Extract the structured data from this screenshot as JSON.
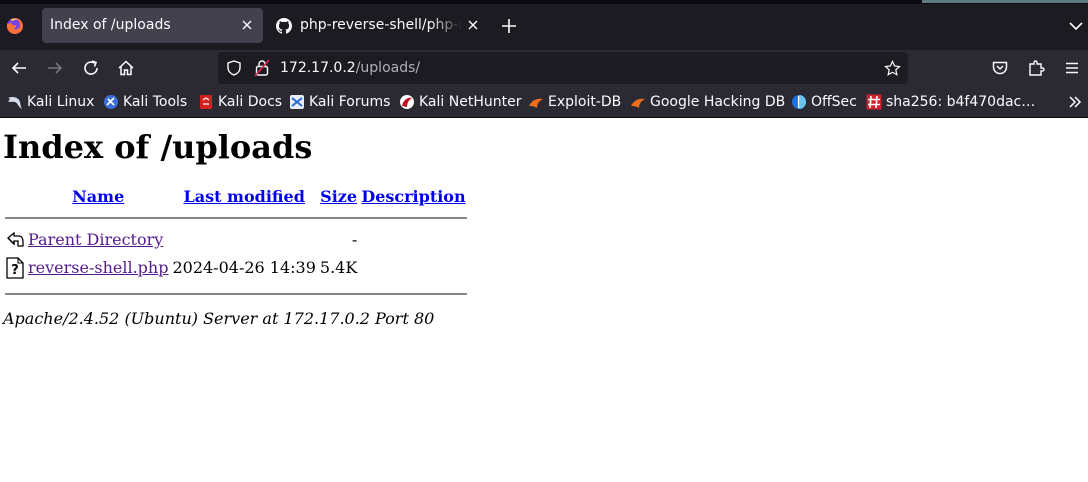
{
  "browser": {
    "tabs": [
      {
        "title": "Index of /uploads",
        "active": true
      },
      {
        "title": "php-reverse-shell/php-re",
        "active": false
      }
    ],
    "url": {
      "host": "172.17.0.2",
      "path": "/uploads/"
    },
    "bookmarks": [
      {
        "label": "Kali Linux",
        "icon": "kali-dragon-icon"
      },
      {
        "label": "Kali Tools",
        "icon": "kali-tools-icon"
      },
      {
        "label": "Kali Docs",
        "icon": "kali-docs-icon"
      },
      {
        "label": "Kali Forums",
        "icon": "kali-forums-icon"
      },
      {
        "label": "Kali NetHunter",
        "icon": "kali-nethunter-icon"
      },
      {
        "label": "Exploit-DB",
        "icon": "exploit-db-icon"
      },
      {
        "label": "Google Hacking DB",
        "icon": "ghdb-icon"
      },
      {
        "label": "OffSec",
        "icon": "offsec-icon"
      },
      {
        "label": "sha256: b4f470dac…",
        "icon": "hash-icon"
      }
    ]
  },
  "page": {
    "heading": "Index of /uploads",
    "columns": {
      "name": "Name",
      "modified": "Last modified",
      "size": "Size",
      "description": "Description"
    },
    "rows": [
      {
        "icon": "parent-directory-icon",
        "name": "Parent Directory",
        "modified": "",
        "size": "-",
        "description": ""
      },
      {
        "icon": "unknown-file-icon",
        "name": "reverse-shell.php",
        "modified": "2024-04-26 14:39",
        "size": "5.4K",
        "description": ""
      }
    ],
    "footer": "Apache/2.4.52 (Ubuntu) Server at 172.17.0.2 Port 80"
  },
  "colors": {
    "link": "#0000ee",
    "visited_link": "#551a8b",
    "chrome_dark": "#1c1b22",
    "toolbar": "#2b2a33"
  }
}
